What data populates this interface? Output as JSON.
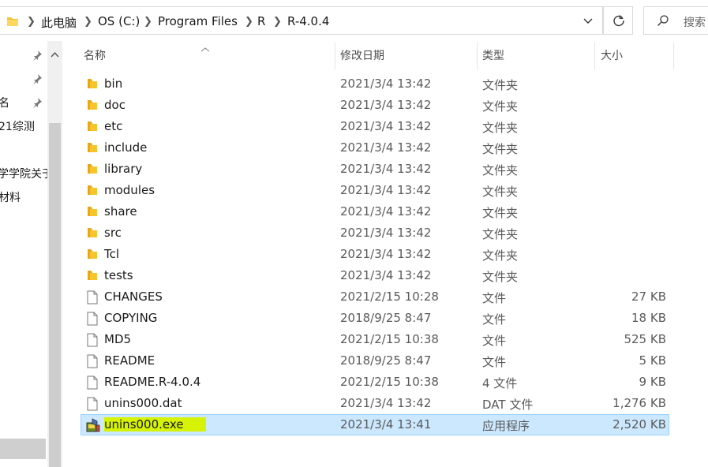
{
  "address": {
    "crumbs": [
      "此电脑",
      "OS (C:)",
      "Program Files",
      "R",
      "R-4.0.4"
    ],
    "search_placeholder": "搜索"
  },
  "nav": {
    "items": [
      "名",
      "21综测",
      "学学院关于",
      "材料"
    ]
  },
  "columns": {
    "name": "名称",
    "date": "修改日期",
    "type": "类型",
    "size": "大小"
  },
  "files": [
    {
      "name": "bin",
      "date": "2021/3/4 13:42",
      "type": "文件夹",
      "size": "",
      "icon": "folder-icon"
    },
    {
      "name": "doc",
      "date": "2021/3/4 13:42",
      "type": "文件夹",
      "size": "",
      "icon": "folder-icon"
    },
    {
      "name": "etc",
      "date": "2021/3/4 13:42",
      "type": "文件夹",
      "size": "",
      "icon": "folder-icon"
    },
    {
      "name": "include",
      "date": "2021/3/4 13:42",
      "type": "文件夹",
      "size": "",
      "icon": "folder-icon"
    },
    {
      "name": "library",
      "date": "2021/3/4 13:42",
      "type": "文件夹",
      "size": "",
      "icon": "folder-icon"
    },
    {
      "name": "modules",
      "date": "2021/3/4 13:42",
      "type": "文件夹",
      "size": "",
      "icon": "folder-icon"
    },
    {
      "name": "share",
      "date": "2021/3/4 13:42",
      "type": "文件夹",
      "size": "",
      "icon": "folder-icon"
    },
    {
      "name": "src",
      "date": "2021/3/4 13:42",
      "type": "文件夹",
      "size": "",
      "icon": "folder-icon"
    },
    {
      "name": "Tcl",
      "date": "2021/3/4 13:42",
      "type": "文件夹",
      "size": "",
      "icon": "folder-icon"
    },
    {
      "name": "tests",
      "date": "2021/3/4 13:42",
      "type": "文件夹",
      "size": "",
      "icon": "folder-icon"
    },
    {
      "name": "CHANGES",
      "date": "2021/2/15 10:28",
      "type": "文件",
      "size": "27 KB",
      "icon": "file-icon"
    },
    {
      "name": "COPYING",
      "date": "2018/9/25 8:47",
      "type": "文件",
      "size": "18 KB",
      "icon": "file-icon"
    },
    {
      "name": "MD5",
      "date": "2021/2/15 10:38",
      "type": "文件",
      "size": "525 KB",
      "icon": "file-icon"
    },
    {
      "name": "README",
      "date": "2018/9/25 8:47",
      "type": "文件",
      "size": "5 KB",
      "icon": "file-icon"
    },
    {
      "name": "README.R-4.0.4",
      "date": "2021/2/15 10:38",
      "type": "4 文件",
      "size": "9 KB",
      "icon": "file-icon"
    },
    {
      "name": "unins000.dat",
      "date": "2021/3/4 13:42",
      "type": "DAT 文件",
      "size": "1,276 KB",
      "icon": "file-icon"
    },
    {
      "name": "unins000.exe",
      "date": "2021/3/4 13:41",
      "type": "应用程序",
      "size": "2,520 KB",
      "icon": "installer-icon",
      "selected": true
    }
  ],
  "colors": {
    "selection": "#cce8ff",
    "selection_border": "#99d1ff",
    "highlight": "#d6f205",
    "folder": "#f8c42c"
  }
}
